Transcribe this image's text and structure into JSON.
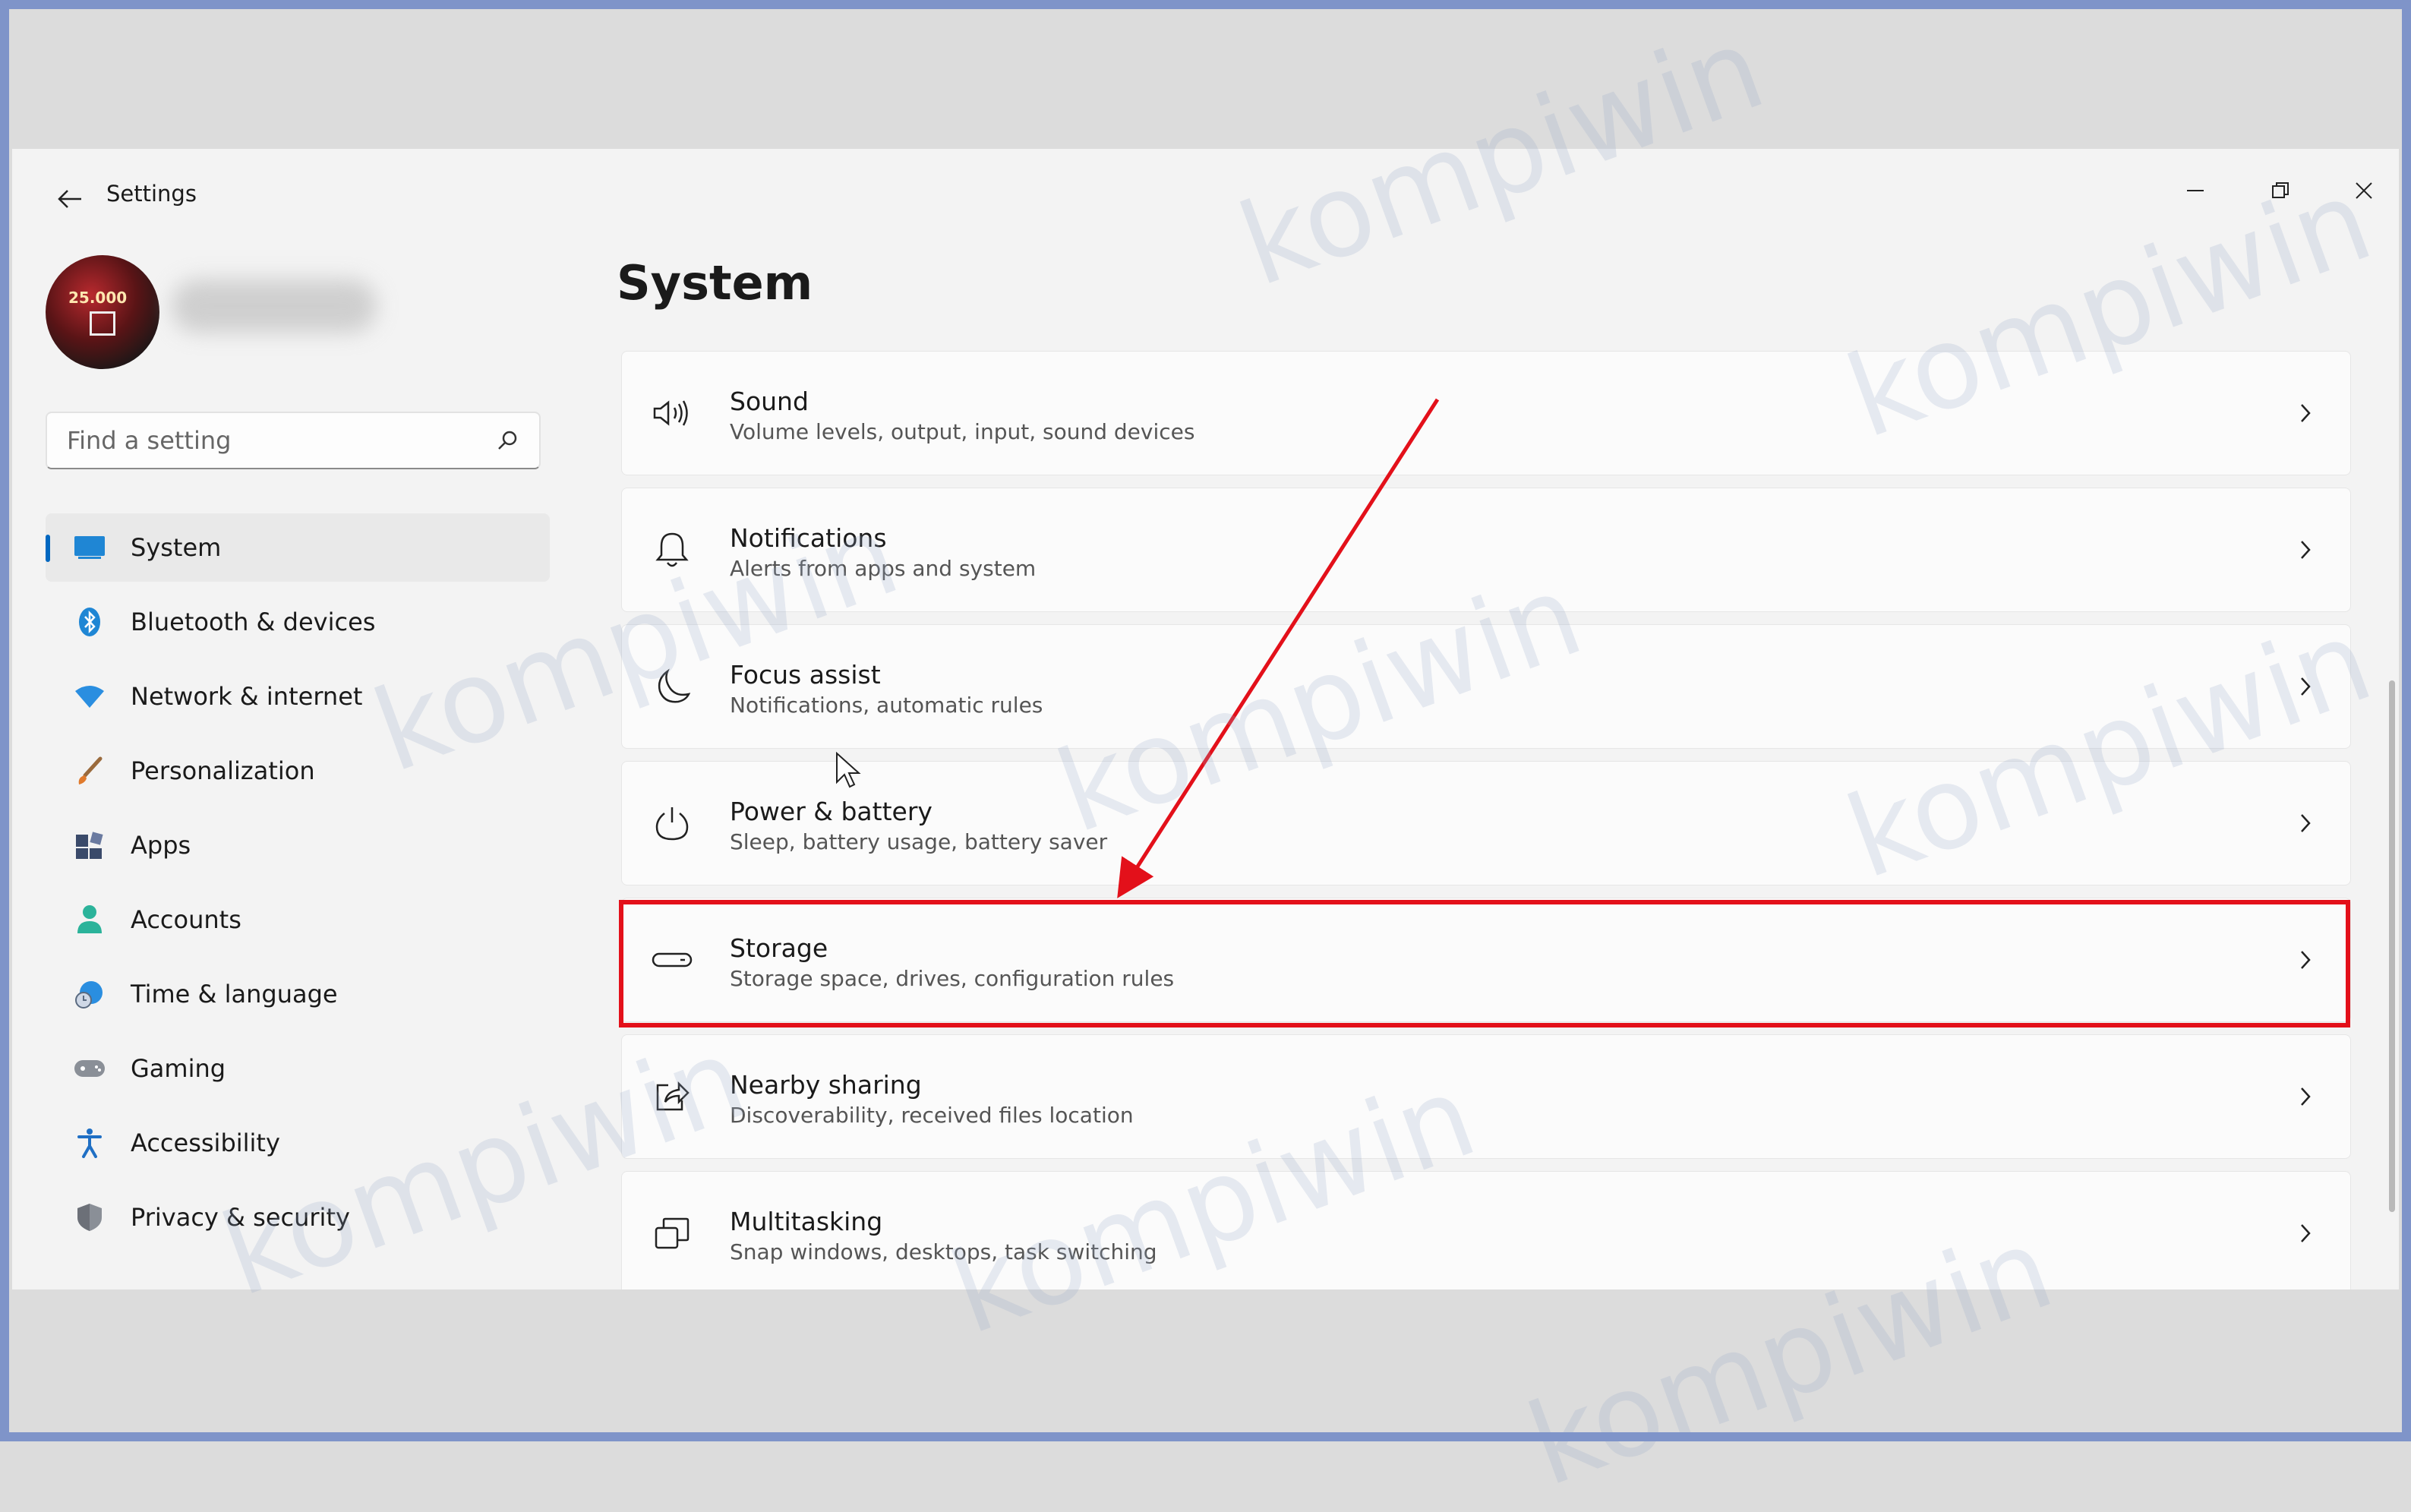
{
  "window": {
    "title": "Settings"
  },
  "controls": {
    "minimize": "minimize",
    "maximize": "restore",
    "close": "close"
  },
  "search": {
    "placeholder": "Find a setting",
    "value": ""
  },
  "avatar": {
    "badge_text": "25.000"
  },
  "page": {
    "title": "System"
  },
  "nav": {
    "items": [
      {
        "label": "System",
        "icon": "monitor-icon",
        "selected": true
      },
      {
        "label": "Bluetooth & devices",
        "icon": "bluetooth-icon"
      },
      {
        "label": "Network & internet",
        "icon": "wifi-icon"
      },
      {
        "label": "Personalization",
        "icon": "brush-icon"
      },
      {
        "label": "Apps",
        "icon": "apps-icon"
      },
      {
        "label": "Accounts",
        "icon": "person-icon"
      },
      {
        "label": "Time & language",
        "icon": "globe-clock-icon"
      },
      {
        "label": "Gaming",
        "icon": "gamepad-icon"
      },
      {
        "label": "Accessibility",
        "icon": "accessibility-icon"
      },
      {
        "label": "Privacy & security",
        "icon": "shield-icon"
      }
    ]
  },
  "cards": [
    {
      "title": "Sound",
      "subtitle": "Volume levels, output, input, sound devices",
      "icon": "speaker-icon"
    },
    {
      "title": "Notifications",
      "subtitle": "Alerts from apps and system",
      "icon": "bell-icon"
    },
    {
      "title": "Focus assist",
      "subtitle": "Notifications, automatic rules",
      "icon": "moon-icon"
    },
    {
      "title": "Power & battery",
      "subtitle": "Sleep, battery usage, battery saver",
      "icon": "power-icon"
    },
    {
      "title": "Storage",
      "subtitle": "Storage space, drives, configuration rules",
      "icon": "drive-icon",
      "highlighted": true
    },
    {
      "title": "Nearby sharing",
      "subtitle": "Discoverability, received files location",
      "icon": "share-icon"
    },
    {
      "title": "Multitasking",
      "subtitle": "Snap windows, desktops, task switching",
      "icon": "windows-stack-icon"
    }
  ],
  "annotation": {
    "color": "#e3101a"
  },
  "watermark": {
    "text": "kompiwin"
  },
  "colors": {
    "accent": "#0067c0",
    "frame": "#7f94c9",
    "background": "#f3f3f3"
  }
}
